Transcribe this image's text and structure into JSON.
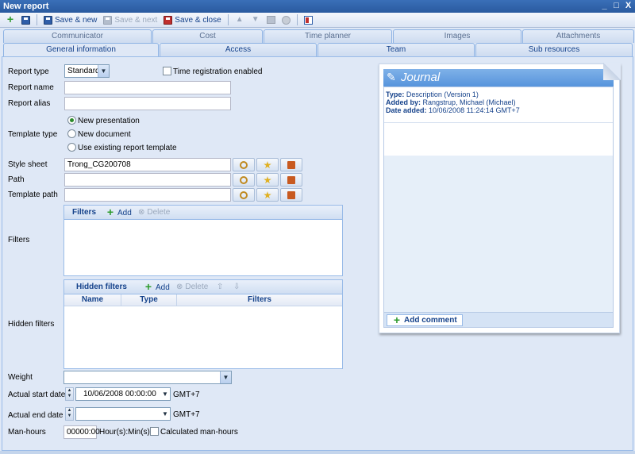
{
  "window": {
    "title": "New report",
    "minimize": "_",
    "maximize": "□",
    "close": "X"
  },
  "toolbar": {
    "save_new": "Save & new",
    "save_next": "Save & next",
    "save_close": "Save & close"
  },
  "tabs_row1": [
    "Communicator",
    "Cost",
    "Time planner",
    "Images",
    "Attachments"
  ],
  "tabs_row2": [
    "General information",
    "Access",
    "Team",
    "Sub resources"
  ],
  "form": {
    "report_type_label": "Report type",
    "report_type_value": "Standard",
    "time_reg_label": "Time registration enabled",
    "report_name_label": "Report name",
    "report_alias_label": "Report alias",
    "template_type_label": "Template type",
    "template_options": [
      "New presentation",
      "New document",
      "Use existing report template"
    ],
    "style_sheet_label": "Style sheet",
    "style_sheet_value": "Trong_CG200708",
    "path_label": "Path",
    "template_path_label": "Template path",
    "filters_label": "Filters",
    "hidden_filters_label": "Hidden filters",
    "weight_label": "Weight",
    "start_date_label": "Actual start date",
    "start_date_value": "10/06/2008 00:00:00",
    "gmt": "GMT+7",
    "end_date_label": "Actual end date",
    "man_hours_label": "Man-hours",
    "man_hours_value": "00000:00",
    "man_hours_unit": "Hour(s):Min(s)",
    "calc_label": "Calculated man-hours"
  },
  "filters_panel": {
    "title": "Filters",
    "add": "Add",
    "delete": "Delete"
  },
  "hidden_panel": {
    "title": "Hidden filters",
    "add": "Add",
    "delete": "Delete",
    "columns": [
      "Name",
      "Type",
      "Filters"
    ]
  },
  "journal": {
    "title": "Journal",
    "type_label": "Type:",
    "type_value": "Description (Version 1)",
    "added_by_label": "Added by:",
    "added_by_value": "Rangstrup, Michael (Michael)",
    "date_label": "Date added:",
    "date_value": "10/06/2008 11:24:14 GMT+7",
    "add_comment": "Add comment"
  }
}
